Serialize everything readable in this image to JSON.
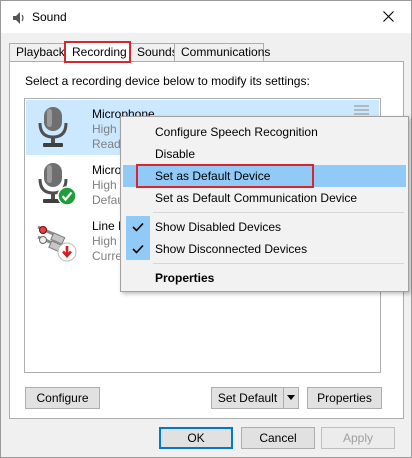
{
  "window": {
    "title": "Sound",
    "icon": "speaker-icon"
  },
  "tabs": [
    {
      "label": "Playback",
      "active": false
    },
    {
      "label": "Recording",
      "active": true
    },
    {
      "label": "Sounds",
      "active": false
    },
    {
      "label": "Communications",
      "active": false
    }
  ],
  "panel": {
    "instruction": "Select a recording device below to modify its settings:"
  },
  "devices": [
    {
      "name": "Microphone",
      "line1": "High D",
      "line2": "Ready",
      "selected": true,
      "icon": "microphone-icon"
    },
    {
      "name": "Microp",
      "line1": "High D",
      "line2": "Defau",
      "selected": false,
      "icon": "microphone-icon",
      "badge": "green-check-icon"
    },
    {
      "name": "Line In",
      "line1": "High D",
      "line2": "Curren",
      "selected": false,
      "icon": "line-in-jack-icon",
      "badge": "red-down-arrow-icon"
    }
  ],
  "context_menu": {
    "items": [
      {
        "label": "Configure Speech Recognition"
      },
      {
        "label": "Disable"
      },
      {
        "label": "Set as Default Device",
        "hovered": true
      },
      {
        "label": "Set as Default Communication Device"
      },
      {
        "label": "Show Disabled Devices",
        "checked": true
      },
      {
        "label": "Show Disconnected Devices",
        "checked": true
      },
      {
        "label": "Properties",
        "bold": true
      }
    ]
  },
  "panel_buttons": {
    "configure": "Configure",
    "set_default": "Set Default",
    "properties": "Properties"
  },
  "dialog_buttons": {
    "ok": "OK",
    "cancel": "Cancel",
    "apply": "Apply"
  },
  "colors": {
    "highlight_box": "#d9262e",
    "selection": "#cce8ff",
    "menu_hover": "#91c9f7"
  }
}
